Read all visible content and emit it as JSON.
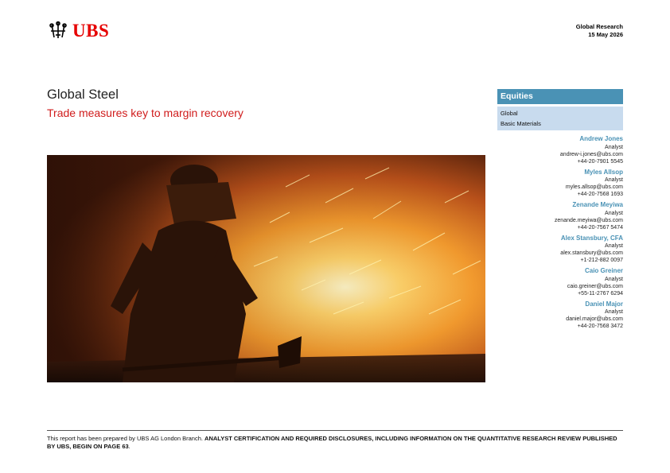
{
  "brand": {
    "name": "UBS",
    "color": "#e60000",
    "logo_icon": "three-keys-icon"
  },
  "header": {
    "section": "Global Research",
    "date": "15 May 2026"
  },
  "report": {
    "title": "Global Steel",
    "subtitle": "Trade measures key to margin recovery"
  },
  "hero_image": {
    "description_icon": "steelworker-photo"
  },
  "sidebar": {
    "category": "Equities",
    "region": "Global",
    "sector": "Basic Materials",
    "accent_color": "#4a92b5",
    "analysts": [
      {
        "name": "Andrew Jones",
        "role": "Analyst",
        "email": "andrew-i.jones@ubs.com",
        "phone": "+44-20-7901 5545"
      },
      {
        "name": "Myles Allsop",
        "role": "Analyst",
        "email": "myles.allsop@ubs.com",
        "phone": "+44-20-7568 1693"
      },
      {
        "name": "Zenande Meyiwa",
        "role": "Analyst",
        "email": "zenande.meyiwa@ubs.com",
        "phone": "+44-20-7567 5474"
      },
      {
        "name": "Alex Stansbury, CFA",
        "role": "Analyst",
        "email": "alex.stansbury@ubs.com",
        "phone": "+1-212-882 0097"
      },
      {
        "name": "Caio Greiner",
        "role": "Analyst",
        "email": "caio.greiner@ubs.com",
        "phone": "+55-11-2767 6294"
      },
      {
        "name": "Daniel Major",
        "role": "Analyst",
        "email": "daniel.major@ubs.com",
        "phone": "+44-20-7568 3472"
      }
    ]
  },
  "footer": {
    "prefix": "This report has been prepared by UBS AG London Branch. ",
    "bold": "ANALYST CERTIFICATION AND REQUIRED DISCLOSURES, INCLUDING INFORMATION ON THE QUANTITATIVE RESEARCH REVIEW PUBLISHED BY UBS, BEGIN ON PAGE 63",
    "suffix": "."
  }
}
